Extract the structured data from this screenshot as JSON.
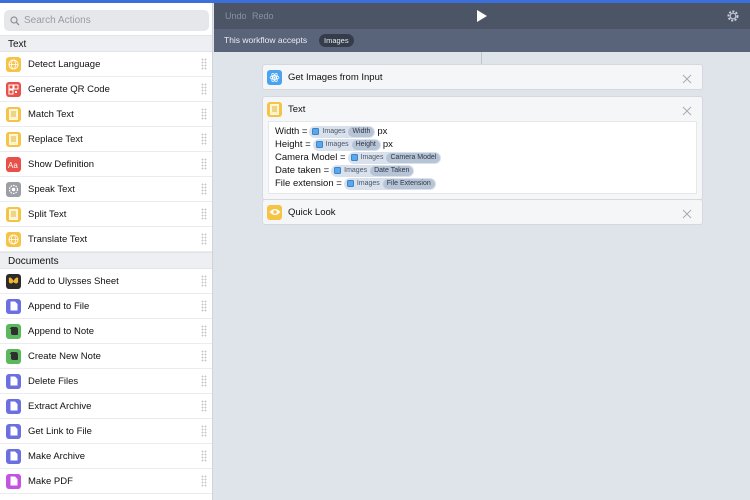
{
  "search": {
    "placeholder": "Search Actions"
  },
  "sidebar": {
    "sections": [
      {
        "title": "Text",
        "items": [
          {
            "label": "Detect Language",
            "icon": "globe-icon",
            "color": "#f6c344"
          },
          {
            "label": "Generate QR Code",
            "icon": "qr-code-icon",
            "color": "#e8504a"
          },
          {
            "label": "Match Text",
            "icon": "text-doc-icon",
            "color": "#f6c344"
          },
          {
            "label": "Replace Text",
            "icon": "text-doc-icon",
            "color": "#f6c344"
          },
          {
            "label": "Show Definition",
            "icon": "dictionary-icon",
            "color": "#e8504a"
          },
          {
            "label": "Speak Text",
            "icon": "speaker-gear-icon",
            "color": "#9b9ea5"
          },
          {
            "label": "Split Text",
            "icon": "text-doc-icon",
            "color": "#f6c344"
          },
          {
            "label": "Translate Text",
            "icon": "globe-icon",
            "color": "#f6c344"
          }
        ]
      },
      {
        "title": "Documents",
        "items": [
          {
            "label": "Add to Ulysses Sheet",
            "icon": "butterfly-icon",
            "color": "#2b2b2b"
          },
          {
            "label": "Append to File",
            "icon": "file-icon",
            "color": "#6c6fe0"
          },
          {
            "label": "Append to Note",
            "icon": "evernote-icon",
            "color": "#5cb85c"
          },
          {
            "label": "Create New Note",
            "icon": "evernote-icon",
            "color": "#5cb85c"
          },
          {
            "label": "Delete Files",
            "icon": "file-icon",
            "color": "#6c6fe0"
          },
          {
            "label": "Extract Archive",
            "icon": "file-icon",
            "color": "#6c6fe0"
          },
          {
            "label": "Get Link to File",
            "icon": "file-icon",
            "color": "#6c6fe0"
          },
          {
            "label": "Make Archive",
            "icon": "file-icon",
            "color": "#6c6fe0"
          },
          {
            "label": "Make PDF",
            "icon": "pdf-icon",
            "color": "#c353e0"
          }
        ]
      }
    ]
  },
  "toolbar": {
    "undo": "Undo",
    "redo": "Redo"
  },
  "accepts": {
    "label": "This workflow accepts",
    "type": "Images"
  },
  "workflow": {
    "card1": {
      "title": "Get Images from Input",
      "icon": "atom-icon",
      "color": "#4aa3ee"
    },
    "card2": {
      "title": "Text",
      "icon": "text-doc-icon",
      "color": "#f6c344",
      "lines": [
        {
          "prefix": "Width = ",
          "var": "Images",
          "prop": "Width",
          "suffix": "px"
        },
        {
          "prefix": "Height = ",
          "var": "Images",
          "prop": "Height",
          "suffix": "px"
        },
        {
          "prefix": "Camera Model = ",
          "var": "Images",
          "prop": "Camera Model",
          "suffix": ""
        },
        {
          "prefix": "Date taken = ",
          "var": "Images",
          "prop": "Date Taken",
          "suffix": ""
        },
        {
          "prefix": "File extension = ",
          "var": "Images",
          "prop": "File Extension",
          "suffix": ""
        }
      ]
    },
    "card3": {
      "title": "Quick Look",
      "icon": "eye-icon",
      "color": "#f6c344"
    }
  }
}
